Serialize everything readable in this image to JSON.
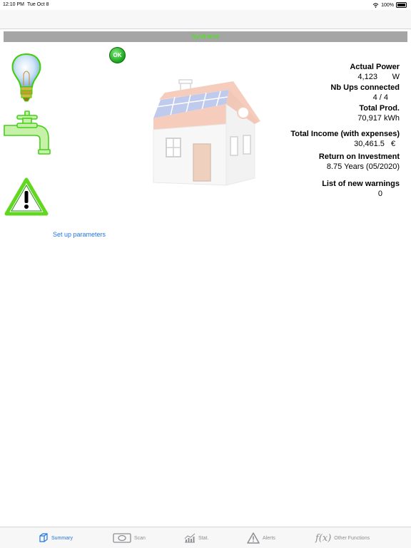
{
  "status_bar": {
    "time": "12:10 PM",
    "date": "Tue Oct 8",
    "battery": "100%"
  },
  "header": {
    "title": "Synthesis"
  },
  "ok_badge": {
    "label": "OK"
  },
  "stats": [
    {
      "label": "Actual Power",
      "value": "4,123",
      "unit": "W"
    },
    {
      "label": "Nb Ups connected",
      "value": "4 / 4",
      "unit": ""
    },
    {
      "label": "Total Prod.",
      "value": "70,917",
      "unit": "kWh"
    },
    {
      "label": "Total Income (with expenses)",
      "value": "30,461.5",
      "unit": "€"
    },
    {
      "label": "Return on Investment",
      "value": "8.75 Years (05/2020)",
      "unit": ""
    },
    {
      "label": "List of new warnings",
      "value": "0",
      "unit": ""
    }
  ],
  "setup_link": {
    "label": "Set up parameters"
  },
  "tabs": [
    {
      "label": "Summary",
      "icon": "cube-icon"
    },
    {
      "label": "Scan",
      "icon": "scan-icon"
    },
    {
      "label": "Stat.",
      "icon": "chart-icon"
    },
    {
      "label": "Alerts",
      "icon": "warning-icon"
    },
    {
      "label": "Other Functions",
      "icon": "function-icon"
    }
  ],
  "colors": {
    "accent": "#1f74e8",
    "header_bg": "#a5a5a5",
    "header_text": "#3cf000",
    "ok_green": "#1aa51a"
  }
}
